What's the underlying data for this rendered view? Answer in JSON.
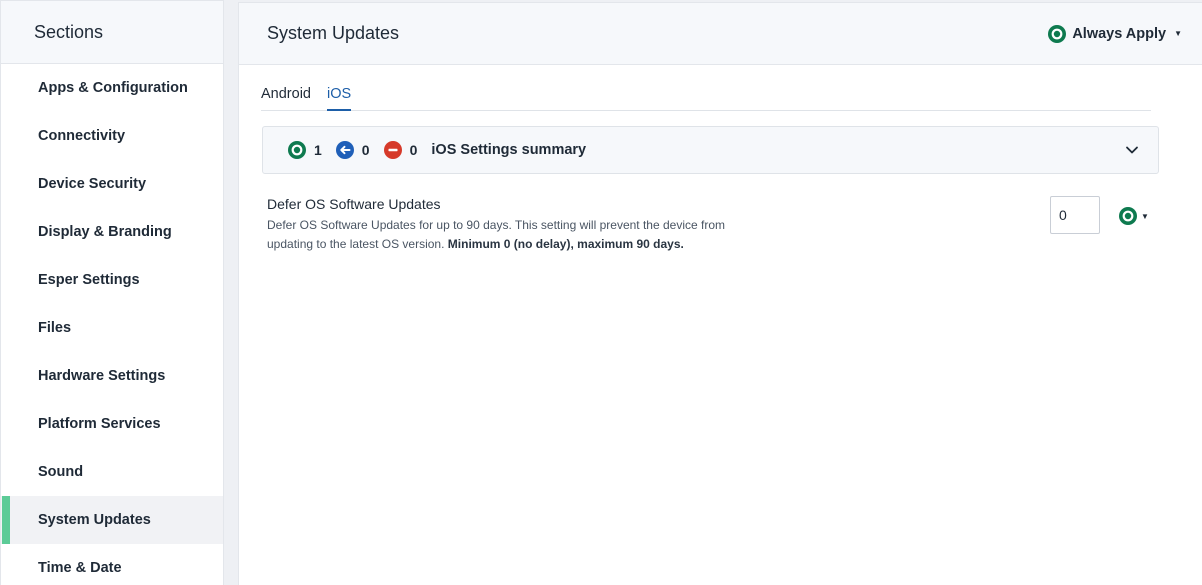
{
  "sidebar": {
    "title": "Sections",
    "items": [
      {
        "label": "Apps & Configuration"
      },
      {
        "label": "Connectivity"
      },
      {
        "label": "Device Security"
      },
      {
        "label": "Display & Branding"
      },
      {
        "label": "Esper Settings"
      },
      {
        "label": "Files"
      },
      {
        "label": "Hardware Settings"
      },
      {
        "label": "Platform Services"
      },
      {
        "label": "Sound"
      },
      {
        "label": "System Updates"
      },
      {
        "label": "Time & Date"
      }
    ],
    "active_index": 9
  },
  "header": {
    "title": "System Updates",
    "apply_label": "Always Apply"
  },
  "tabs": [
    {
      "label": "Android"
    },
    {
      "label": "iOS"
    }
  ],
  "summary": {
    "applied_count": "1",
    "inherited_count": "0",
    "blocked_count": "0",
    "title": "iOS Settings summary"
  },
  "setting": {
    "title": "Defer OS Software Updates",
    "description": "Defer OS Software Updates for up to 90 days. This setting will prevent the device from updating to the latest OS version.",
    "description_bold": "Minimum 0 (no delay), maximum 90 days.",
    "value": "0"
  },
  "colors": {
    "accent_green": "#0e7a4f",
    "active_tab_blue": "#1d5ea8",
    "inherit_blue": "#1f5fb8",
    "block_red": "#d63a2a",
    "sidebar_active_bar": "#5ccb97"
  },
  "icons": {
    "apply": "always-apply-icon",
    "inherit": "inherit-arrow-icon",
    "block": "block-minus-icon",
    "expand": "chevron-down-icon"
  }
}
